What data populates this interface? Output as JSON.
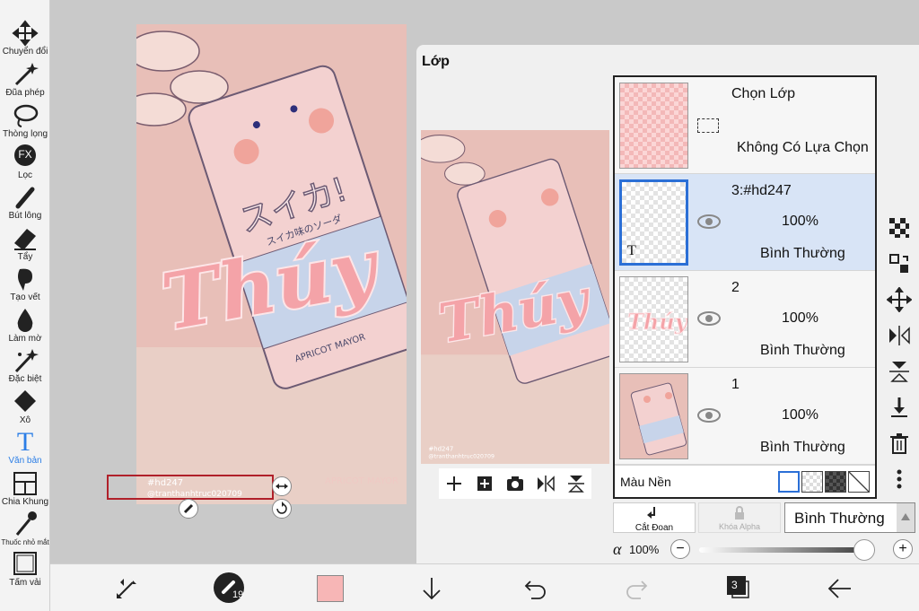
{
  "tools": [
    {
      "label": "Chuyển đổi",
      "icon": "move-icon"
    },
    {
      "label": "Đũa phép",
      "icon": "magic-wand-icon"
    },
    {
      "label": "Thòng lọng",
      "icon": "lasso-icon"
    },
    {
      "label": "Lọc",
      "icon": "fx-filter-icon",
      "glyph": "FX"
    },
    {
      "label": "Bút lông",
      "icon": "brush-icon"
    },
    {
      "label": "Tẩy",
      "icon": "eraser-icon"
    },
    {
      "label": "Tạo vết",
      "icon": "smudge-icon"
    },
    {
      "label": "Làm mờ",
      "icon": "blur-icon"
    },
    {
      "label": "Đặc biệt",
      "icon": "special-icon"
    },
    {
      "label": "Xô",
      "icon": "bucket-icon"
    },
    {
      "label": "Văn bản",
      "icon": "text-icon",
      "glyph": "T",
      "active": true
    },
    {
      "label": "Chia Khung",
      "icon": "frame-divider-icon"
    },
    {
      "label": "Thuốc nhỏ mắt",
      "icon": "eyedropper-icon"
    },
    {
      "label": "Tấm vải",
      "icon": "canvas-icon"
    }
  ],
  "artwork": {
    "title_text": "Thúy",
    "can_text": "スイカ!",
    "can_subtext": "スイカ味のソーダ",
    "can_brand": "APRICOT MAYOR",
    "watermark_line1": "#hd247",
    "watermark_line2": "@tranthanhtruc020709"
  },
  "layer_panel": {
    "title": "Lớp",
    "selection_layer": {
      "name": "Chọn Lớp",
      "status": "Không Có Lựa Chọn"
    },
    "layers": [
      {
        "name": "3:#hd247",
        "opacity": "100%",
        "blend": "Bình Thường",
        "selected": true,
        "type_marker": "T"
      },
      {
        "name": "2",
        "opacity": "100%",
        "blend": "Bình Thường",
        "selected": false
      },
      {
        "name": "1",
        "opacity": "100%",
        "blend": "Bình Thường",
        "selected": false
      }
    ],
    "background_label": "Màu Nền",
    "clip_label": "Cắt Đoan",
    "alpha_lock_label": "Khóa Alpha",
    "blend_mode": "Bình Thường",
    "alpha_symbol": "α",
    "alpha_value": "100%",
    "alpha_fraction": 1.0
  },
  "bottom_bar": {
    "brush_size": "19",
    "color": "#f7b6b6",
    "layer_count": "3"
  },
  "colors": {
    "accent": "#2b7ee6",
    "selection_blue": "#2b6fd6",
    "pink": "#f4a3a8"
  }
}
